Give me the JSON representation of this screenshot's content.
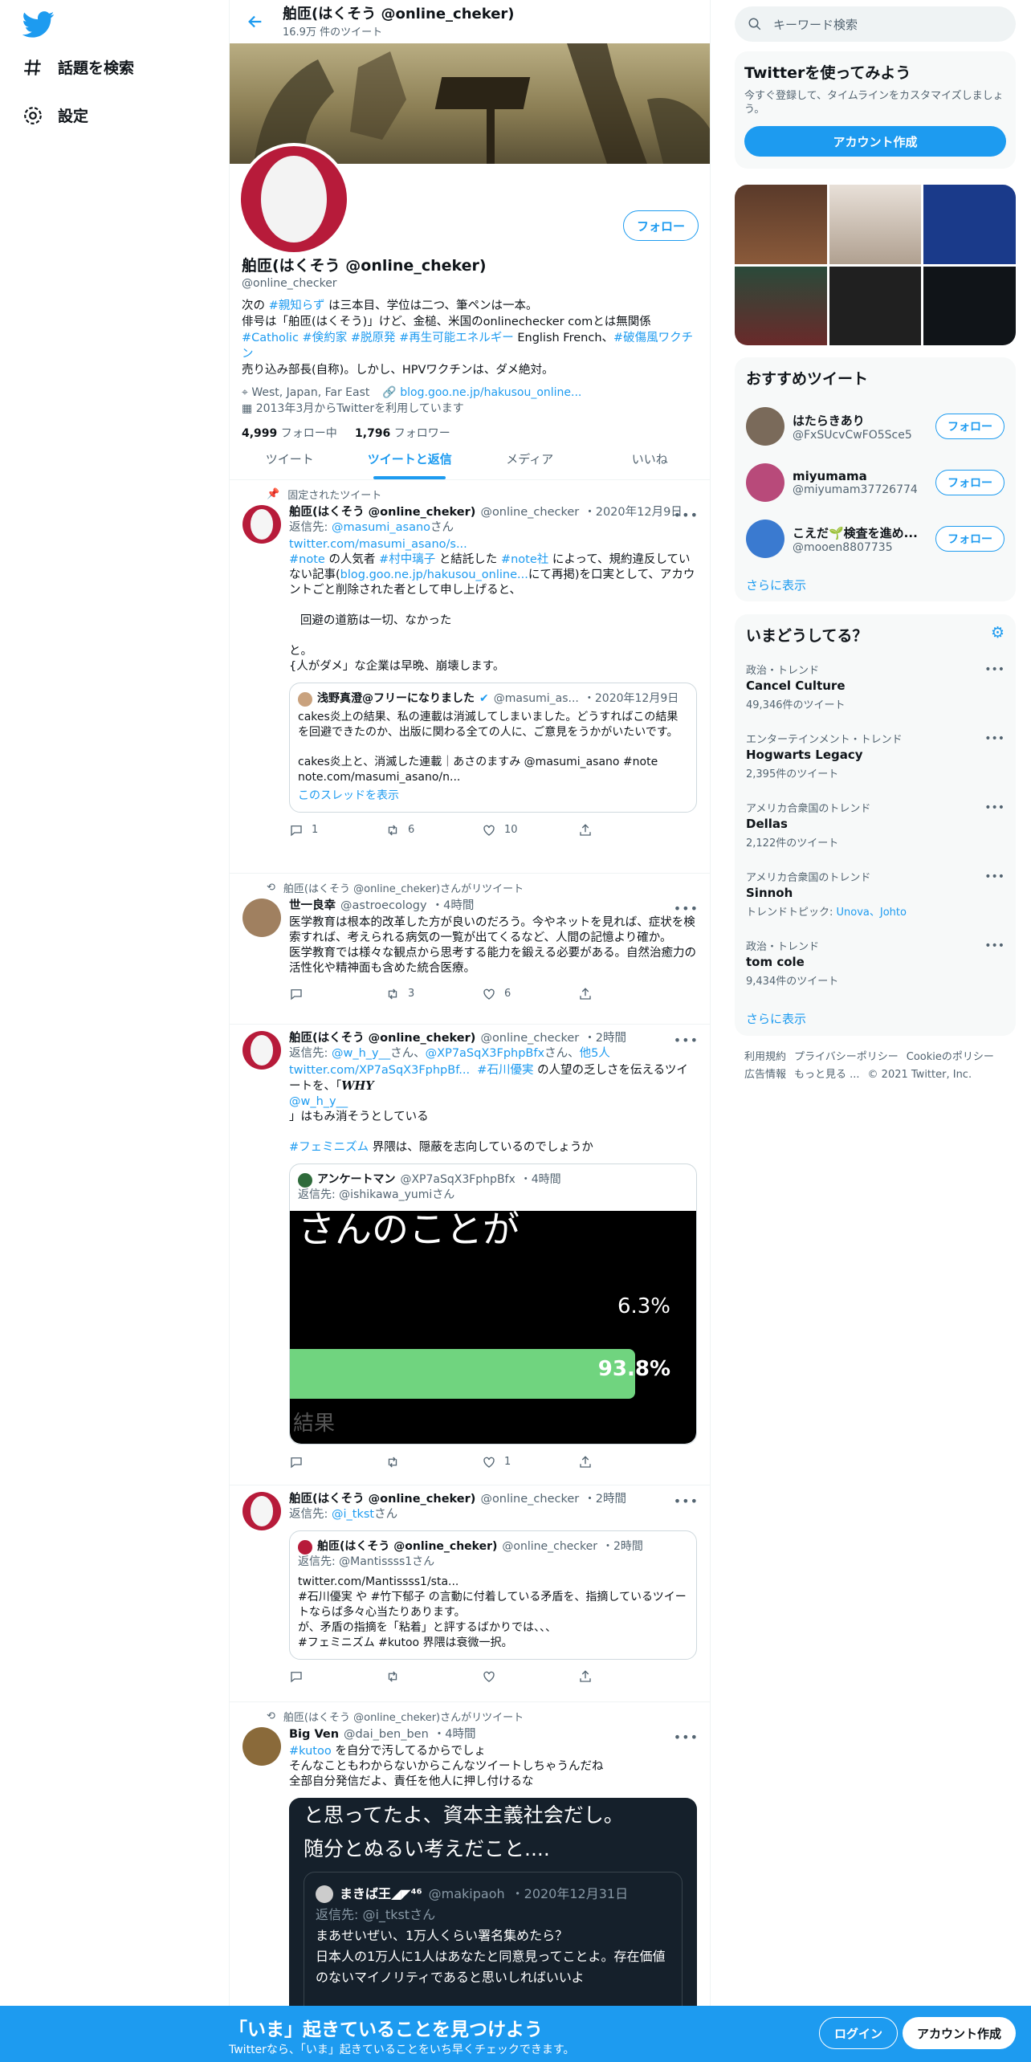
{
  "nav": {
    "logo_icon": "twitter-bird-icon",
    "explore": "話題を検索",
    "settings": "設定"
  },
  "header": {
    "name": "舶匝(はくそう @online_cheker)",
    "tweet_count": "16.9万 件のツイート"
  },
  "profile": {
    "follow_button": "フォロー",
    "display_name": "舶匝(はくそう @online_cheker)",
    "handle": "@online_checker",
    "bio": {
      "line1_a": "次の",
      "line1_tag": "#親知らず",
      "line1_b": "は三本目、学位は二つ、筆ペンは一本。",
      "line2": "俳号は「舶匝(はくそう)」けど、金槌、米国のonlinechecker comとは無関係",
      "line3_tags": [
        "#Catholic",
        "#倹約家",
        "#脱原発",
        "#再生可能エネルギー"
      ],
      "line3_text": "English French、",
      "line3_tag_last": "#破傷風ワクチン",
      "line4": "売り込み部長(自称)。しかし、HPVワクチンは、ダメ絶対。"
    },
    "location": "West, Japan, Far East",
    "link": "blog.goo.ne.jp/hakusou_online...",
    "joined": "2013年3月からTwitterを利用しています",
    "following_count": "4,999",
    "following_label": "フォロー中",
    "followers_count": "1,796",
    "followers_label": "フォロワー"
  },
  "tabs": [
    "ツイート",
    "ツイートと返信",
    "メディア",
    "いいね"
  ],
  "tweets": {
    "t1": {
      "pinned_label": "固定されたツイート",
      "name": "舶匝(はくそう @online_cheker)",
      "handle": "@online_checker",
      "date": "・2020年12月9日",
      "reply_to_label": "返信先:",
      "reply_to": "@masumi_asano",
      "reply_suffix": "さん",
      "link": "twitter.com/masumi_asano/s...",
      "p1_tag1": "#note",
      "p1_a": "の人気者",
      "p1_tag2": "#村中璃子",
      "p1_b": "と結託した",
      "p1_tag3": "#note社",
      "p1_c": "によって、規約違反していない記事(",
      "p1_link": "blog.goo.ne.jp/hakusou_online...",
      "p1_d": "にて再掲)を口実として、アカウントごと削除された者として申し上げると、",
      "p2": "回避の道筋は一切、なかった",
      "p3": "と。",
      "p4": "{人がダメ」な企業は早晩、崩壊します。",
      "quote": {
        "name": "浅野真澄@フリーになりました",
        "handle": "@masumi_as...",
        "date": "・2020年12月9日",
        "text1": "cakes炎上の結果、私の連載は消滅してしまいました。どうすればこの結果を回避できたのか、出版に関わる全ての人に、ご意見をうかがいたいです。",
        "text2": "cakes炎上と、消滅した連載｜あさのますみ @masumi_asano #note note.com/masumi_asano/n...",
        "thread": "このスレッドを表示"
      },
      "replies": "1",
      "retweets": "6",
      "likes": "10"
    },
    "t2": {
      "rt_label": "舶匝(はくそう @online_cheker)さんがリツイート",
      "name": "世一良幸",
      "handle": "@astroecology",
      "date": "・4時間",
      "p1": "医学教育は根本的改革した方が良いのだろう。今やネットを見れば、症状を検索すれば、考えられる病気の一覧が出てくるなど、人間の記憶より確か。",
      "p2": "医学教育では様々な観点から思考する能力を鍛える必要がある。自然治癒力の活性化や精神面も含めた統合医療。",
      "replies": "",
      "retweets": "3",
      "likes": "6"
    },
    "t3": {
      "name": "舶匝(はくそう @online_cheker)",
      "handle": "@online_checker",
      "date": "・2時間",
      "reply_to_label": "返信先:",
      "reply_users": [
        "@w_h_y__",
        "@XP7aSqX3FphpBfx",
        "他5人"
      ],
      "reply_users_sep1": "さん、",
      "reply_users_sep2": "さん、",
      "link": "twitter.com/XP7aSqX3FphpBf...",
      "tag1": "#石川優実",
      "a": "の人望の乏しさを伝えるツイートを、「",
      "why": "WHY",
      "mention": "@w_h_y__",
      "b": "」はもみ消そうとしている",
      "tag2": "#フェミニズム",
      "c": "界隈は、隠蔽を志向しているのでしょうか",
      "quote": {
        "name": "アンケートマン",
        "handle": "@XP7aSqX3FphpBfx",
        "date": "・4時間",
        "reply_line": "返信先: @ishikawa_yumiさん",
        "img_big": "さんのことが",
        "img_pct1": "6.3%",
        "img_pct2": "93.8%",
        "img_res": "結果"
      },
      "replies": "",
      "retweets": "",
      "likes": "1"
    },
    "t4": {
      "name": "舶匝(はくそう @online_cheker)",
      "handle": "@online_checker",
      "date": "・2時間",
      "reply_to_label": "返信先:",
      "reply_to": "@i_tkst",
      "reply_suffix": "さん",
      "quote": {
        "name": "舶匝(はくそう @online_cheker)",
        "handle": "@online_checker",
        "date": "・2時間",
        "reply_line": "返信先: @Mantissss1さん",
        "l1": "twitter.com/Mantissss1/sta...",
        "l2": "#石川優実 や #竹下郁子 の言動に付着している矛盾を、指摘しているツイートならば多々心当たりあります。",
        "l3": "が、矛盾の指摘を「粘着」と評するばかりでは、、、",
        "l4": "#フェミニズム #kutoo 界隈は衰微一択。"
      }
    },
    "t5": {
      "rt_label": "舶匝(はくそう @online_cheker)さんがリツイート",
      "name": "Big Ven",
      "handle": "@dai_ben_ben",
      "date": "・4時間",
      "tag": "#kutoo",
      "a": "を自分で汚してるからでしょ",
      "b": "そんなこともわからないからこんなツイートしちゃうんだね",
      "c": "全部自分発信だよ、責任を他人に押し付けるな",
      "img_l1": "と思ってたよ、資本主義社会だし。",
      "img_l2": "随分とぬるい考えだこと....",
      "img_q_name": "まきば王◢◤⁴⁶",
      "img_q_handle": "@makipaoh",
      "img_q_date": "・2020年12月31日",
      "img_q_reply": "返信先: @i_tkstさん",
      "img_q_l1": "まあせいぜい、1万人くらい署名集めたら？",
      "img_q_l2": "日本人の1万人に1人はあなたと同意見ってことよ。存在価値のないマイノリティであると思いしればいいよ"
    }
  },
  "right": {
    "search_placeholder": "キーワード検索",
    "try_title": "Twitterを使ってみよう",
    "try_desc": "今すぐ登録して、タイムラインをカスタマイズしましょう。",
    "try_button": "アカウント作成",
    "rec_title": "おすすめツイート",
    "rec_users": [
      {
        "name": "はたらきあり",
        "handle": "@FxSUcvCwFO5Sce5"
      },
      {
        "name": "miyumama",
        "handle": "@miyumam37726774"
      },
      {
        "name": "こえだ🌱検査を進め...",
        "handle": "@mooen8807735"
      }
    ],
    "follow_label": "フォロー",
    "show_more": "さらに表示",
    "trends_title": "いまどうしてる？",
    "trends": [
      {
        "context": "政治・トレンド",
        "name": "Cancel Culture",
        "count": "49,346件のツイート"
      },
      {
        "context": "エンターテインメント・トレンド",
        "name": "Hogwarts Legacy",
        "count": "2,395件のツイート"
      },
      {
        "context": "アメリカ合衆国のトレンド",
        "name": "Dellas",
        "count": "2,122件のツイート"
      },
      {
        "context": "アメリカ合衆国のトレンド",
        "name": "Sinnoh",
        "count_prefix": "トレンドトピック:",
        "topics": "Unova、Johto"
      },
      {
        "context": "政治・トレンド",
        "name": "tom cole",
        "count": "9,434件のツイート"
      }
    ],
    "footer": [
      "利用規約",
      "プライバシーポリシー",
      "Cookieのポリシー",
      "広告情報",
      "もっと見る ...",
      "© 2021 Twitter, Inc."
    ]
  },
  "bottombar": {
    "headline": "「いま」起きていることを見つけよう",
    "sub": "Twitterなら、「いま」起きていることをいち早くチェックできます。",
    "login": "ログイン",
    "signup": "アカウント作成"
  },
  "colors": {
    "accent": "#1d9bf0",
    "bottom_bar": "#1d9bf0",
    "avatar_red": "#b71b3a"
  }
}
